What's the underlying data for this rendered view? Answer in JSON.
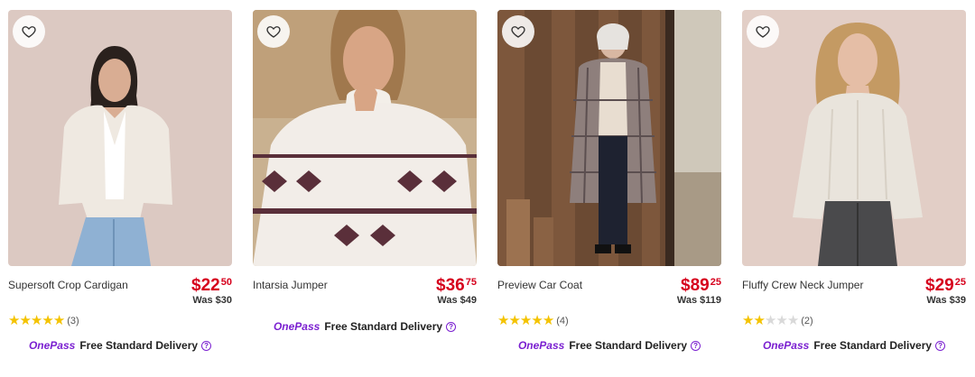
{
  "products": [
    {
      "name": "Supersoft Crop Cardigan",
      "price_dollars": "$22",
      "price_cents": "50",
      "was": "Was $30",
      "rating": 5,
      "rating_count": "(3)",
      "delivery_brand": "OnePass",
      "delivery_text": "Free Standard Delivery",
      "wishlist_icon": "heart-outline-icon",
      "help_icon": "question-circle-icon"
    },
    {
      "name": "Intarsia Jumper",
      "price_dollars": "$36",
      "price_cents": "75",
      "was": "Was $49",
      "rating": null,
      "rating_count": "",
      "delivery_brand": "OnePass",
      "delivery_text": "Free Standard Delivery",
      "wishlist_icon": "heart-outline-icon",
      "help_icon": "question-circle-icon"
    },
    {
      "name": "Preview Car Coat",
      "price_dollars": "$89",
      "price_cents": "25",
      "was": "Was $119",
      "rating": 5,
      "rating_count": "(4)",
      "delivery_brand": "OnePass",
      "delivery_text": "Free Standard Delivery",
      "wishlist_icon": "heart-outline-icon",
      "help_icon": "question-circle-icon"
    },
    {
      "name": "Fluffy Crew Neck Jumper",
      "price_dollars": "$29",
      "price_cents": "25",
      "was": "Was $39",
      "rating": 2,
      "rating_count": "(2)",
      "delivery_brand": "OnePass",
      "delivery_text": "Free Standard Delivery",
      "wishlist_icon": "heart-outline-icon",
      "help_icon": "question-circle-icon"
    }
  ],
  "colors": {
    "price": "#d6001c",
    "onepass": "#7a1fd0",
    "star_on": "#f4c300",
    "star_off": "#d9d9d9"
  }
}
